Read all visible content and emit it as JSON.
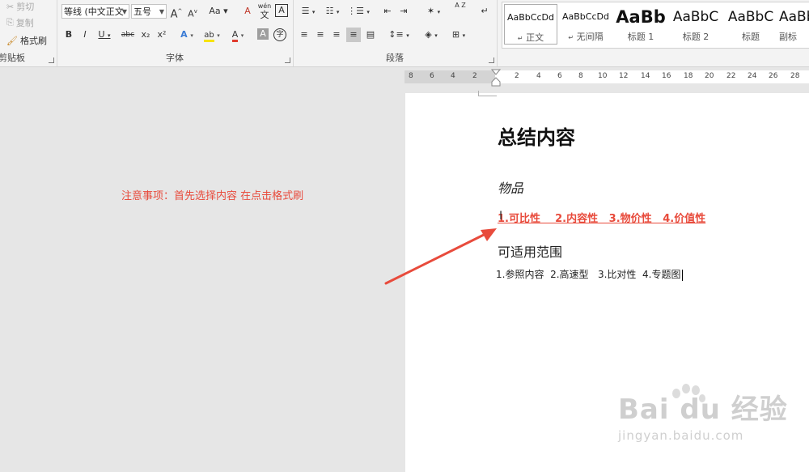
{
  "ribbon": {
    "clipboard": {
      "cut_label": "剪切",
      "copy_label": "复制",
      "format_painter_label": "格式刷",
      "group_label": "剪贴板"
    },
    "font": {
      "font_name": "等线 (中文正文",
      "font_size": "五号",
      "group_label": "字体",
      "grow_label": "A",
      "shrink_label": "A",
      "case_label": "Aa",
      "clear_format_label": "A",
      "pinyin_label": "wén",
      "pinyin_char": "文",
      "border_char_label": "A",
      "bold": "B",
      "italic": "I",
      "underline": "U",
      "strike": "abc",
      "subscript": "x₂",
      "superscript": "x²",
      "text_effect": "A",
      "highlight": "ab",
      "font_color": "A",
      "char_shading": "A",
      "enclose_char": "字",
      "font_color_hex": "#e03b2e",
      "highlight_hex": "#f7e300"
    },
    "paragraph": {
      "group_label": "段落",
      "sort_label": "A Z"
    },
    "styles": [
      {
        "sample": "AaBbCcDd",
        "name": "正文"
      },
      {
        "sample": "AaBbCcDd",
        "name": "无间隔"
      },
      {
        "sample": "AaBb",
        "name": "标题 1"
      },
      {
        "sample": "AaBbC",
        "name": "标题 2"
      },
      {
        "sample": "AaBbC",
        "name": "标题"
      },
      {
        "sample": "AaBb",
        "name": "副标"
      }
    ]
  },
  "ruler": {
    "left_ticks": [
      "8",
      "6",
      "4",
      "2"
    ],
    "right_ticks": [
      "2",
      "4",
      "6",
      "8",
      "10",
      "12",
      "14",
      "16",
      "18",
      "20",
      "22",
      "24",
      "26",
      "28"
    ]
  },
  "annotation": {
    "note": "注意事项：首先选择内容 在点击格式刷",
    "arrow_color": "#e84b3c"
  },
  "document": {
    "title": "总结内容",
    "item": "物品",
    "red_line": "1.可比性    2.内容性   3.物价性   4.价值性",
    "subheading": "可适用范围",
    "list_line": "1.参照内容  2.高速型   3.比对性  4.专题图"
  },
  "watermark": {
    "main": "Bai du 经验",
    "url": "jingyan.baidu.com"
  }
}
